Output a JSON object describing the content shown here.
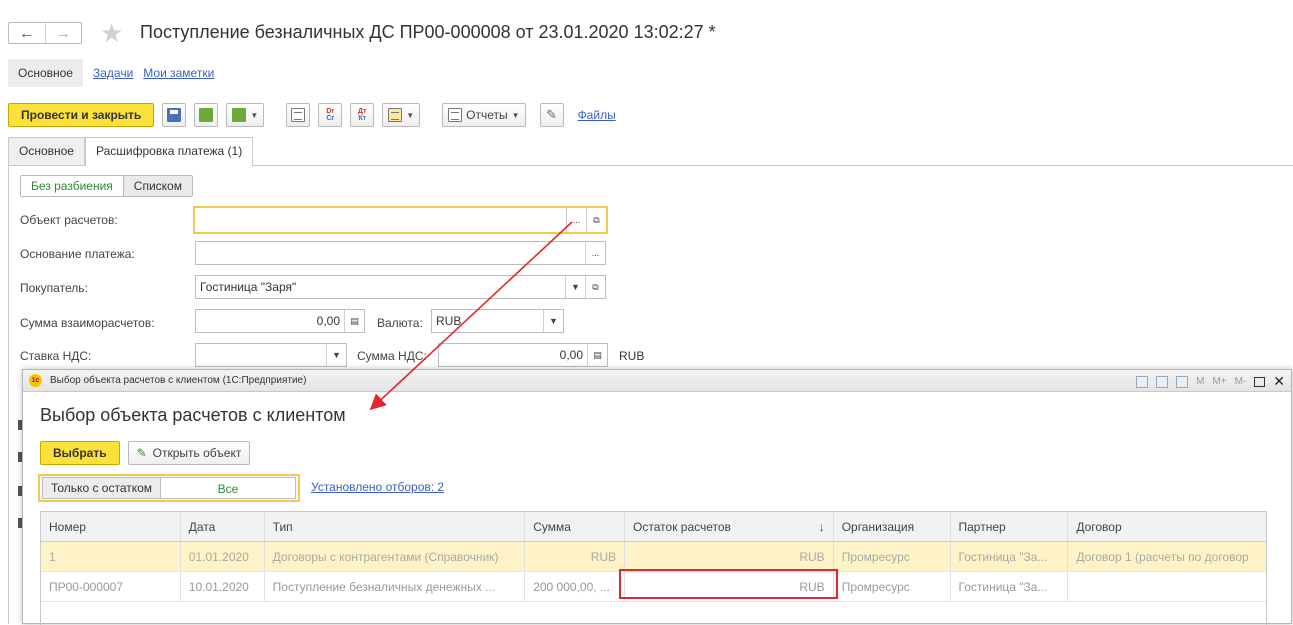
{
  "header": {
    "back_glyph": "←",
    "forward_glyph": "→",
    "favorite_glyph": "★",
    "title": "Поступление безналичных ДС ПР00-000008 от 23.01.2020 13:02:27 *"
  },
  "topnav": {
    "items": [
      "Основное",
      "Задачи",
      "Мои заметки"
    ]
  },
  "toolbar": {
    "post_close": "Провести и закрыть",
    "reports": "Отчеты",
    "files": "Файлы",
    "dt_label": "Dr",
    "ct_label": "Cr",
    "dt_ru": "Дт",
    "kt_ru": "Кт"
  },
  "tabs": [
    "Основное",
    "Расшифровка платежа (1)"
  ],
  "toggle": {
    "on": "Без разбиения",
    "off": "Списком"
  },
  "form": {
    "object_label": "Объект расчетов:",
    "basis_label": "Основание платежа:",
    "buyer_label": "Покупатель:",
    "buyer_value": "Гостиница \"Заря\"",
    "sum_label": "Сумма взаиморасчетов:",
    "sum_value": "0,00",
    "currency_label": "Валюта:",
    "currency_value": "RUB",
    "vat_label": "Ставка НДС:",
    "vat_sum_label": "Сумма НДС:",
    "vat_sum_value": "0,00",
    "vat_currency": "RUB",
    "ellipsis": "..."
  },
  "modal": {
    "window_title": "Выбор объекта расчетов с клиентом  (1С:Предприятие)",
    "logo": "1с",
    "mem": [
      "M",
      "M+",
      "M-"
    ],
    "heading": "Выбор объекта расчетов с клиентом",
    "select_button": "Выбрать",
    "open_button": "Открыть объект",
    "filter_label": "Только с остатком",
    "filter_value": "Все",
    "filters_link": "Установлено отборов: 2",
    "columns": [
      "Номер",
      "Дата",
      "Тип",
      "Сумма",
      "Остаток расчетов",
      "Организация",
      "Партнер",
      "Договор"
    ],
    "sort_glyph": "↓",
    "rows": [
      [
        "1",
        "01.01.2020",
        "Договоры с контрагентами (Справочник)",
        "RUB",
        "RUB",
        "Промресурс",
        "Гостиница \"За...",
        "Договор 1 (расчеты по договор"
      ],
      [
        "ПР00-000007",
        "10.01.2020",
        "Поступление безналичных денежных ...",
        "200 000,00, ...",
        "RUB",
        "Промресурс",
        "Гостиница \"За...",
        ""
      ]
    ]
  },
  "colors": {
    "accent_yellow": "#fbe13a",
    "link_blue": "#3a5fc4",
    "arrow_red": "#e3262d",
    "toggle_green": "#2e8b2e"
  }
}
